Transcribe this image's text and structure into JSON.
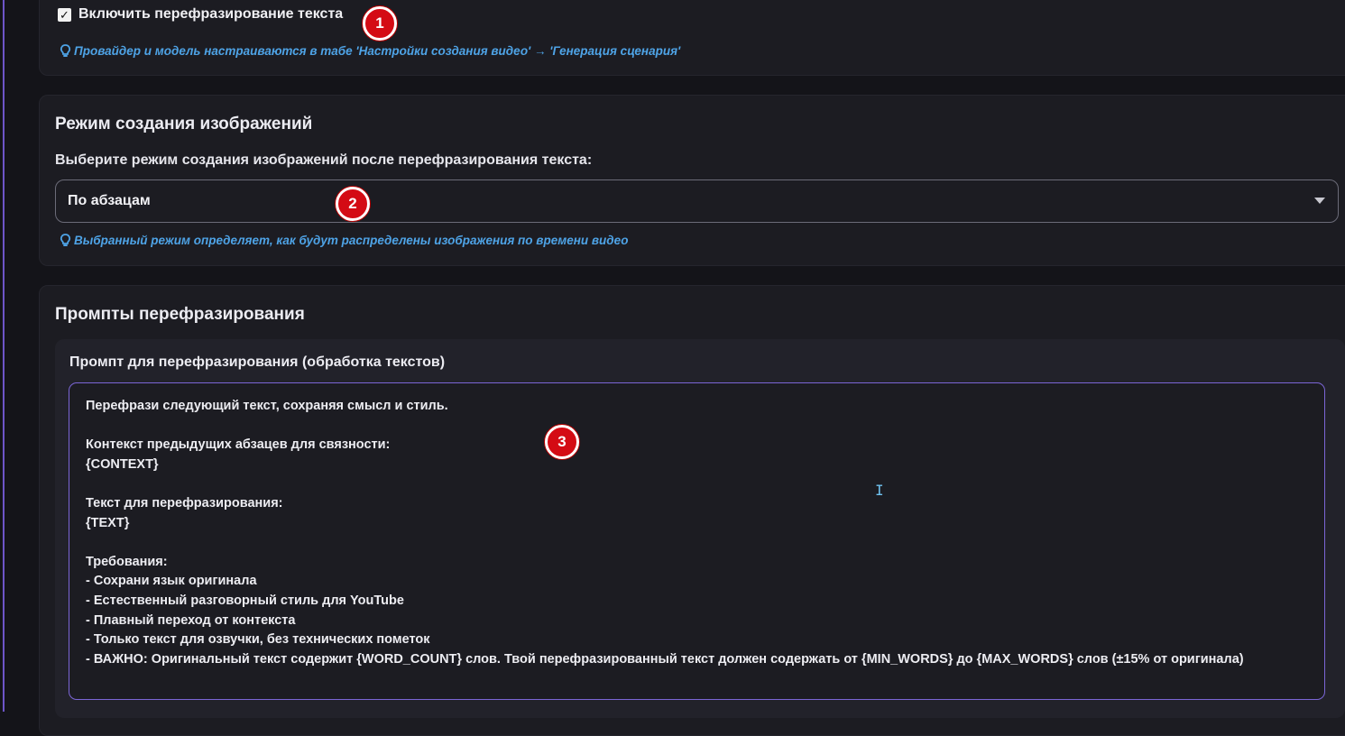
{
  "paraphrase_section": {
    "checkbox_checked": true,
    "checkbox_label": "Включить перефразирование текста",
    "hint": "Провайдер и модель настраиваются в табе 'Настройки создания видео' → 'Генерация сценария'"
  },
  "image_mode_section": {
    "title": "Режим создания изображений",
    "select_label": "Выберите режим создания изображений после перефразирования текста:",
    "selected_value": "По абзацам",
    "hint": "Выбранный режим определяет, как будут распределены изображения по времени видео"
  },
  "prompts_section": {
    "title": "Промпты перефразирования",
    "prompt_label": "Промпт для перефразирования (обработка текстов)",
    "prompt_text": "Перефрази следующий текст, сохраняя смысл и стиль.\n\nКонтекст предыдущих абзацев для связности:\n{CONTEXT}\n\nТекст для перефразирования:\n{TEXT}\n\nТребования:\n- Сохрани язык оригинала\n- Естественный разговорный стиль для YouTube\n- Плавный переход от контекста\n- Только текст для озвучки, без технических пометок\n- ВАЖНО: Оригинальный текст содержит {WORD_COUNT} слов. Твой перефразированный текст должен содержать от {MIN_WORDS} до {MAX_WORDS} слов (±15% от оригинала)"
  },
  "markers": [
    "1",
    "2",
    "3"
  ],
  "icons": {
    "hint_icon": "bulb-icon",
    "select_icon": "caret-down-icon",
    "cursor_icon": "text-cursor-icon"
  },
  "colors": {
    "accent": "#7b66d6",
    "hint": "#4ea3e6",
    "marker": "#d40b14"
  }
}
